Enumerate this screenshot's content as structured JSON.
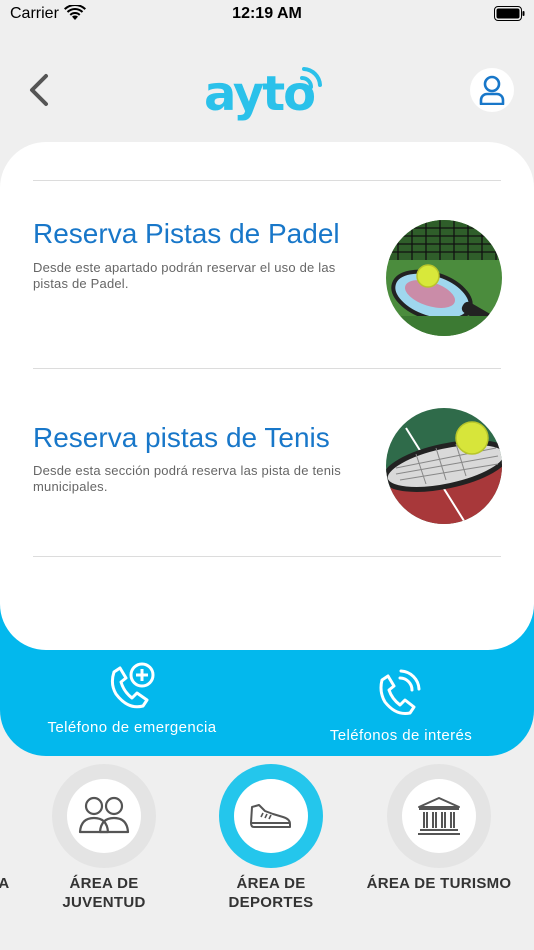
{
  "status_bar": {
    "carrier": "Carrier",
    "time": "12:19 AM"
  },
  "header": {
    "logo_text": "ayto"
  },
  "items": [
    {
      "title": "Reserva Pistas de Padel",
      "description": "Desde este apartado podrán reservar el uso de las pistas de Padel."
    },
    {
      "title": "Reserva pistas de Tenis",
      "description": "Desde esta sección podrá reserva las pista de tenis municipales."
    }
  ],
  "phones": {
    "emergency_label": "Teléfono de emergencia",
    "interest_label": "Teléfonos de interés"
  },
  "categories": [
    {
      "label": "A",
      "active": false
    },
    {
      "label": "ÁREA DE JUVENTUD",
      "active": false
    },
    {
      "label": "ÁREA DE DEPORTES",
      "active": true
    },
    {
      "label": "ÁREA DE TURISMO",
      "active": false
    }
  ],
  "colors": {
    "brand_blue": "#03b8ed",
    "title_blue": "#1877c9",
    "active_ring": "#24c6ec"
  }
}
